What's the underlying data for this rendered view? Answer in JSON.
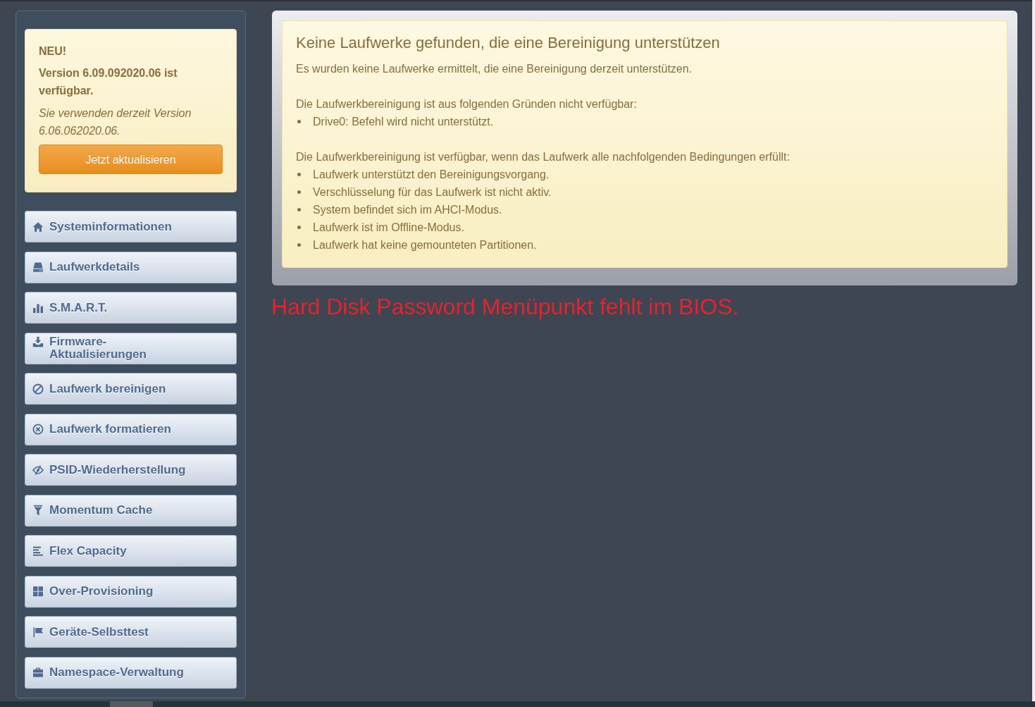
{
  "update_notice": {
    "badge": "NEU!",
    "headline": "Version 6.09.092020.06 ist verfügbar.",
    "current_version": "Sie verwenden derzeit Version 6.06.062020.06.",
    "button": "Jetzt aktualisieren"
  },
  "sidebar": {
    "items": [
      {
        "label": "Systeminformationen",
        "selected": false
      },
      {
        "label": "Laufwerkdetails",
        "selected": false
      },
      {
        "label": "S.M.A.R.T.",
        "selected": false
      },
      {
        "label": "Firmware-Aktualisierungen",
        "selected": false
      },
      {
        "label": "Laufwerk bereinigen",
        "selected": false
      },
      {
        "label": "Laufwerk formatieren",
        "selected": false
      },
      {
        "label": "PSID-Wiederherstellung",
        "selected": false
      },
      {
        "label": "Momentum Cache",
        "selected": false
      },
      {
        "label": "Flex Capacity",
        "selected": false
      },
      {
        "label": "Over-Provisioning",
        "selected": false
      },
      {
        "label": "Geräte-Selbsttest",
        "selected": false
      },
      {
        "label": "Namespace-Verwaltung",
        "selected": false
      }
    ]
  },
  "message": {
    "title": "Keine Laufwerke gefunden, die eine Bereinigung unterstützen",
    "intro": "Es wurden keine Laufwerke ermittelt, die eine Bereinigung derzeit unterstützen.",
    "reasons_heading": "Die Laufwerkbereinigung ist aus folgenden Gründen nicht verfügbar:",
    "reasons": [
      "Drive0: Befehl wird nicht unterstützt."
    ],
    "conditions_heading": "Die Laufwerkbereinigung ist verfügbar, wenn das Laufwerk alle nachfolgenden Bedingungen erfüllt:",
    "conditions": [
      "Laufwerk unterstützt den Bereinigungsvorgang.",
      "Verschlüsselung für das Laufwerk ist nicht aktiv.",
      "System befindet sich im AHCI-Modus.",
      "Laufwerk ist im Offline-Modus.",
      "Laufwerk hat keine gemounteten Partitionen."
    ]
  },
  "annotation": {
    "text": "Hard Disk Password Menüpunkt fehlt im BIOS."
  }
}
